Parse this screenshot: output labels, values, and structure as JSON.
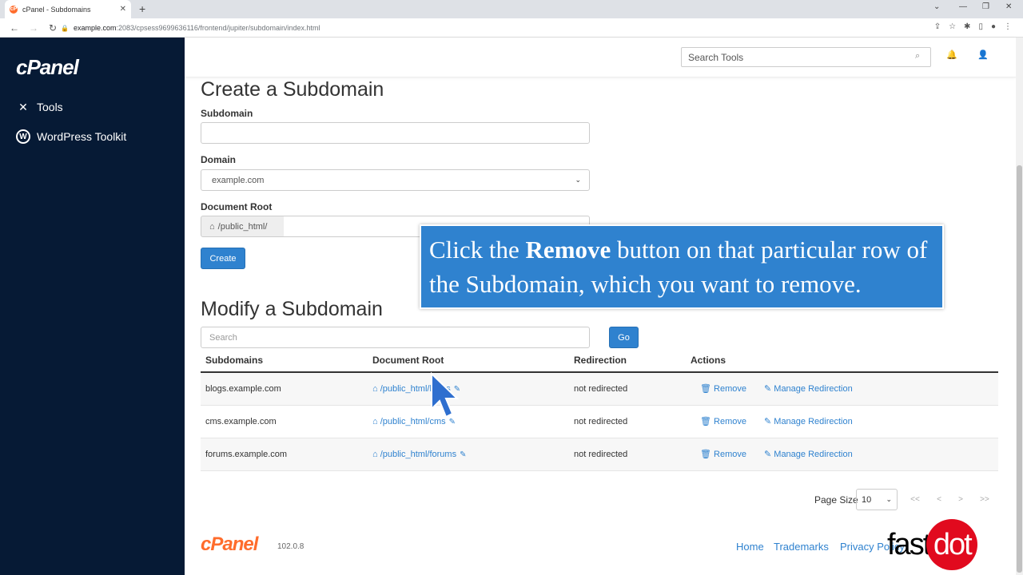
{
  "browser": {
    "tab_title": "cPanel - Subdomains",
    "tab_favicon": "cP",
    "url_host": "example.com",
    "url_path": ":2083/cpsess9699636116/frontend/jupiter/subdomain/index.html"
  },
  "sidebar": {
    "logo": "cPanel",
    "items": [
      {
        "label": "Tools",
        "icon": "tools-icon"
      },
      {
        "label": "WordPress Toolkit",
        "icon": "wordpress-icon"
      }
    ]
  },
  "topbar": {
    "search_placeholder": "Search Tools"
  },
  "create": {
    "title": "Create a Subdomain",
    "subdomain_label": "Subdomain",
    "subdomain_value": "",
    "domain_label": "Domain",
    "domain_value": "example.com",
    "docroot_label": "Document Root",
    "docroot_prefix": "/public_html/",
    "create_button": "Create"
  },
  "modify": {
    "title": "Modify a Subdomain",
    "search_placeholder": "Search",
    "go_button": "Go",
    "columns": [
      "Subdomains",
      "Document Root",
      "Redirection",
      "Actions"
    ],
    "rows": [
      {
        "subdomain": "blogs.example.com",
        "docroot": "/public_html/blogs",
        "redirection": "not redirected",
        "remove": "Remove",
        "manage": "Manage Redirection"
      },
      {
        "subdomain": "cms.example.com",
        "docroot": "/public_html/cms",
        "redirection": "not redirected",
        "remove": "Remove",
        "manage": "Manage Redirection"
      },
      {
        "subdomain": "forums.example.com",
        "docroot": "/public_html/forums",
        "redirection": "not redirected",
        "remove": "Remove",
        "manage": "Manage Redirection"
      }
    ],
    "page_size_label": "Page Size",
    "page_size_value": "10",
    "pager": [
      "<<",
      "<",
      ">",
      ">>"
    ]
  },
  "footer": {
    "logo": "cPanel",
    "version": "102.0.8",
    "links": [
      "Home",
      "Trademarks",
      "Privacy Policy"
    ]
  },
  "overlay": {
    "text_before": "Click the ",
    "text_bold": "Remove",
    "text_after": " button on that particular row of the Subdomain, which you want to remove.",
    "brand": "fast",
    "brand_dot": "dot"
  },
  "colors": {
    "sidebar_bg": "#061a35",
    "accent": "#2f82cf",
    "brand_orange": "#ff6c2c"
  }
}
